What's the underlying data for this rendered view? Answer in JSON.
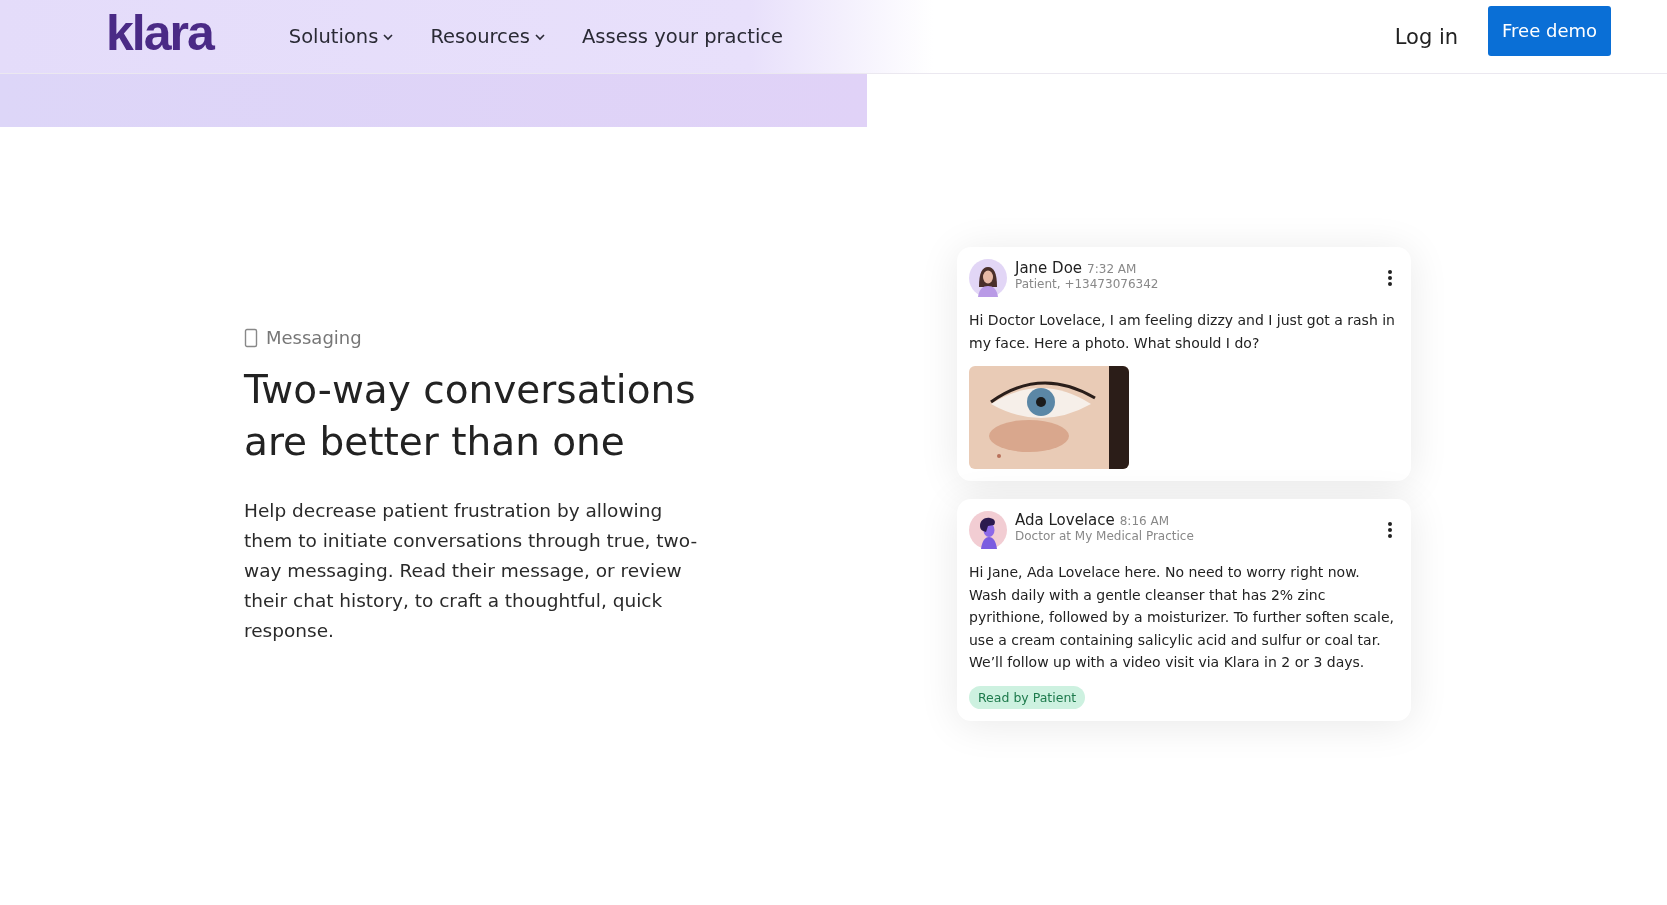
{
  "header": {
    "logo": "klara",
    "nav": [
      {
        "label": "Solutions",
        "dropdown": true
      },
      {
        "label": "Resources",
        "dropdown": true
      },
      {
        "label": "Assess your practice",
        "dropdown": false
      }
    ],
    "login": "Log in",
    "cta": "Free demo"
  },
  "feature": {
    "eyebrow": "Messaging",
    "title": "Two-way conversations are better than one",
    "body": "Help decrease patient frustration by allowing them to initiate conversations through true, two-way messaging. Read their message, or review their chat history, to craft a thoughtful, quick response."
  },
  "messages": [
    {
      "kind": "patient",
      "name": "Jane Doe",
      "time": "7:32 AM",
      "role": "Patient, +13473076342",
      "text": "Hi Doctor Lovelace, I am feeling dizzy and I just got a rash in my face. Here a photo. What should I do?"
    },
    {
      "kind": "doctor",
      "name": "Ada Lovelace",
      "time": "8:16 AM",
      "role": "Doctor at My Medical Practice",
      "text": "Hi Jane, Ada Lovelace here. No need to worry right now. Wash daily with a gentle cleanser that has 2% zinc pyrithione, followed by a moisturizer. To further soften scale, use a cream containing salicylic acid and sulfur or coal tar. We’ll follow up with a video visit via Klara in 2 or 3 days.",
      "status": "Read by Patient"
    }
  ]
}
